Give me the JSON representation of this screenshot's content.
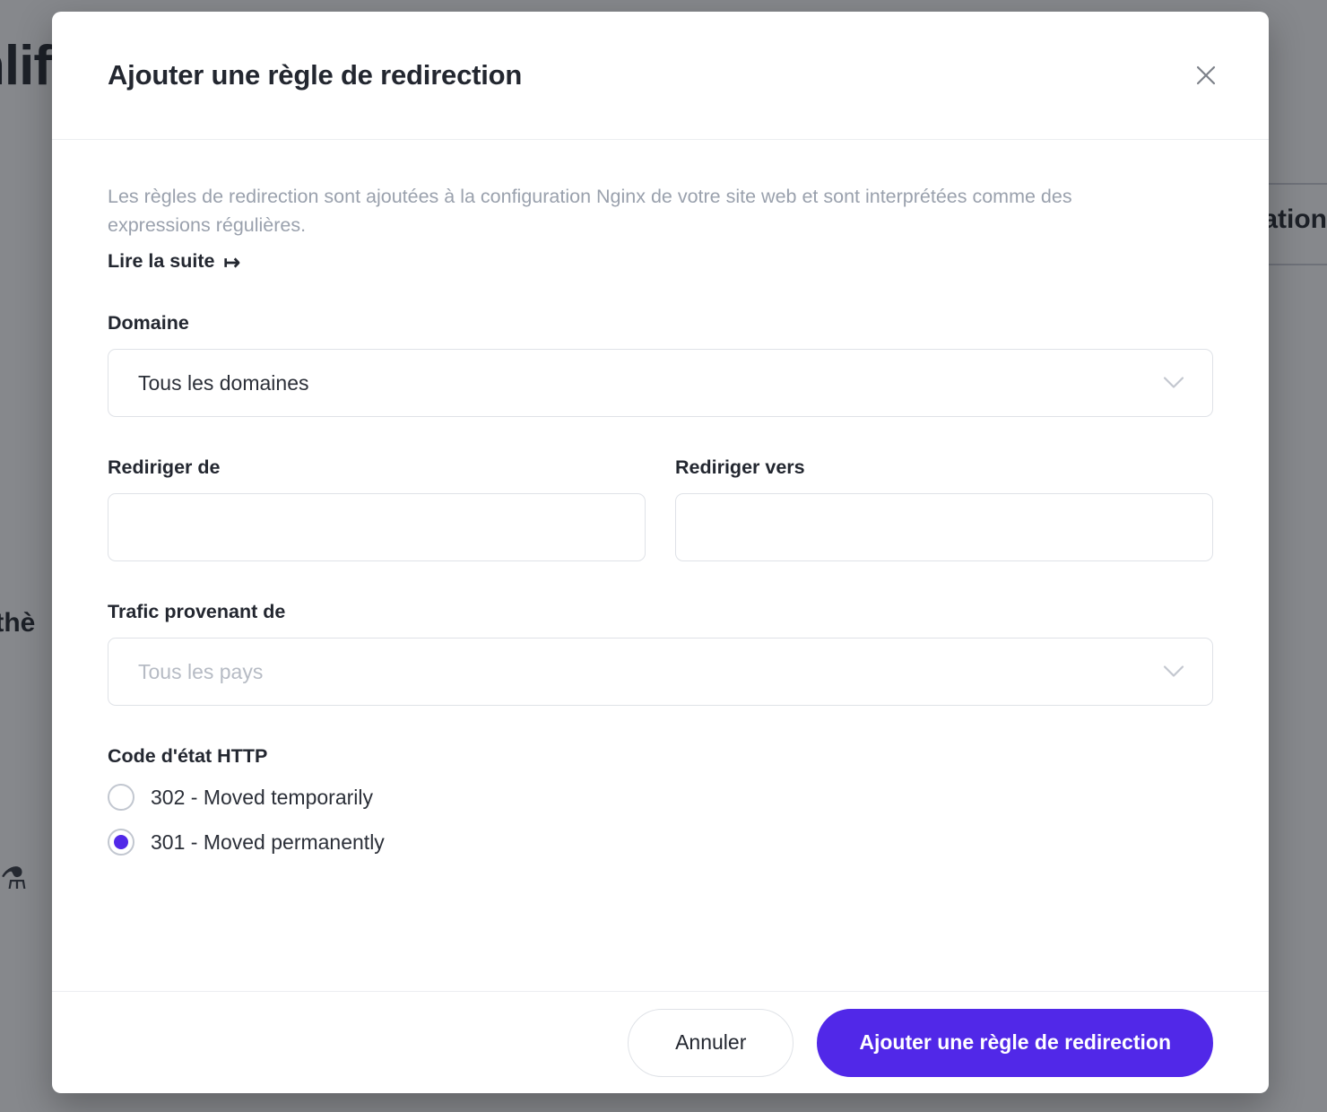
{
  "background": {
    "brand_text": "nlif",
    "doc_tab_text": "tation",
    "snippet_left_top": "",
    "snippet_left_mid": "t thè",
    "flask_icon": "flask-icon"
  },
  "modal": {
    "title": "Ajouter une règle de redirection",
    "close_icon": "close-icon",
    "description": "Les règles de redirection sont ajoutées à la configuration Nginx de votre site web et sont interprétées comme des expressions régulières.",
    "read_more_label": "Lire la suite",
    "read_more_icon": "↦",
    "fields": {
      "domain": {
        "label": "Domaine",
        "value": "Tous les domaines",
        "is_placeholder": false,
        "chevron_icon": "chevron-down-icon"
      },
      "redirect_from": {
        "label": "Rediriger de",
        "value": "",
        "placeholder": ""
      },
      "redirect_to": {
        "label": "Rediriger vers",
        "value": "",
        "placeholder": ""
      },
      "traffic_from": {
        "label": "Trafic provenant de",
        "value": "Tous les pays",
        "is_placeholder": true,
        "chevron_icon": "chevron-down-icon"
      },
      "status_code": {
        "label": "Code d'état HTTP",
        "options": [
          {
            "label": "302 - Moved temporarily",
            "checked": false
          },
          {
            "label": "301 - Moved permanently",
            "checked": true
          }
        ]
      }
    },
    "footer": {
      "cancel_label": "Annuler",
      "submit_label": "Ajouter une règle de redirection"
    }
  },
  "colors": {
    "accent": "#5128e8",
    "title": "#232730",
    "muted_text": "#9aa1ad",
    "border": "#dfe2e7"
  }
}
